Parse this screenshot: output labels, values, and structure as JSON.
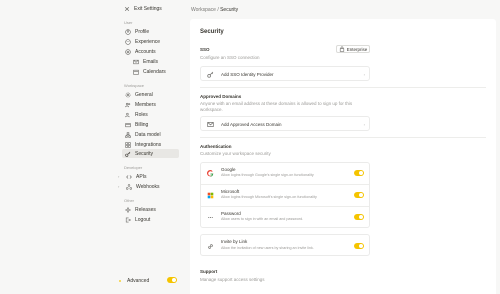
{
  "sidebar": {
    "exit_label": "Exit Settings",
    "sections": {
      "user": "User",
      "workspace": "Workspace",
      "developer": "Developer",
      "other": "Other"
    },
    "user_items": [
      "Profile",
      "Experience",
      "Accounts"
    ],
    "account_subitems": [
      "Emails",
      "Calendars"
    ],
    "workspace_items": [
      "General",
      "Members",
      "Roles",
      "Billing",
      "Data model",
      "Integrations",
      "Security"
    ],
    "developer_items": [
      "APIs",
      "Webhooks"
    ],
    "other_items": [
      "Releases",
      "Logout"
    ],
    "advanced_label": "Advanced",
    "advanced_enabled": true
  },
  "breadcrumb": {
    "parent": "Workspace",
    "separator": "/",
    "current": "Security"
  },
  "main": {
    "title": "Security",
    "sso": {
      "title": "SSO",
      "description": "Configure an SSO connection",
      "badge": "Enterprise",
      "action": "Add SSO Identity Provider"
    },
    "domains": {
      "title": "Approved Domains",
      "description": "Anyone with an email address at these domains is allowed to sign up for this workspace.",
      "action": "Add Approved Access Domain"
    },
    "auth": {
      "title": "Authentication",
      "description": "Customize your workspace security",
      "methods": [
        {
          "name": "Google",
          "desc": "Allow logins through Google's single sign-on functionality",
          "enabled": true
        },
        {
          "name": "Microsoft",
          "desc": "Allow logins through Microsoft's single sign-on functionality",
          "enabled": true
        },
        {
          "name": "Password",
          "desc": "Allow users to sign in with an email and password.",
          "enabled": true
        }
      ],
      "invite": {
        "name": "Invite by Link",
        "desc": "Allow the invitation of new users by sharing an invite link.",
        "enabled": true
      }
    },
    "support": {
      "title": "Support",
      "description": "Manage support access settings"
    }
  },
  "colors": {
    "accent": "#f5c400",
    "active_bg": "#e8e7e4",
    "page_bg": "#f7f7f6"
  }
}
